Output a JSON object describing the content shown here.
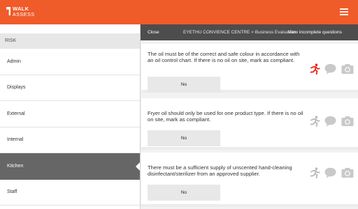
{
  "header": {
    "brand_line1": "WALK",
    "brand_line2": "ASSESS",
    "accent_color": "#f05b2a",
    "menu_icon": "hamburger-icon"
  },
  "sidebar": {
    "section_title": "RISK",
    "items": [
      {
        "label": "Admin",
        "active": false
      },
      {
        "label": "Displays",
        "active": false
      },
      {
        "label": "External",
        "active": false
      },
      {
        "label": "Internal",
        "active": false
      },
      {
        "label": "Kitchen",
        "active": true
      },
      {
        "label": "Staff",
        "active": false
      }
    ]
  },
  "panel": {
    "close_label": "Close",
    "breadcrumb": "EYETHU CONVIENCE CENTRE  >  Business Evaluation",
    "view_incomplete_label": "View incomplete questions",
    "questions": [
      {
        "text": "The oil must be of the correct and safe colour in accordance with an oil control chart.  If there is no oil on site, mark as compliant.",
        "answer": "No",
        "status_color": "#e8251c"
      },
      {
        "text": "Fryer oil should only be used for one product type.  If there is no oil on site, mark as compliant.",
        "answer": "No",
        "status_color": "#b9b9b9"
      },
      {
        "text": "There must be a  sufficient supply of unscented hand-cleaning disinfectant/sterilizer from an approved supplier.",
        "answer": "No",
        "status_color": "#b9b9b9"
      }
    ],
    "icons": [
      "running-man-icon",
      "comment-icon",
      "camera-icon"
    ]
  }
}
